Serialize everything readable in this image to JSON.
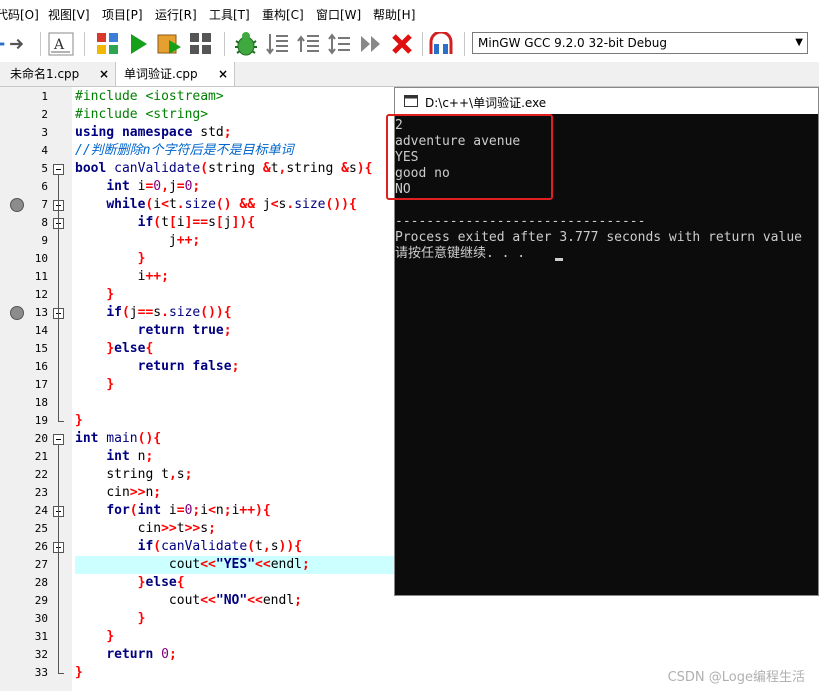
{
  "menu": [
    "代码[O]",
    "视图[V]",
    "项目[P]",
    "运行[R]",
    "工具[T]",
    "重构[C]",
    "窗口[W]",
    "帮助[H]"
  ],
  "toolbar": {
    "compiler": "MinGW GCC 9.2.0 32-bit Debug",
    "icons": [
      "forward-arrow-icon",
      "format-icon",
      "new-project-icon",
      "run-icon",
      "compile-run-icon",
      "grid-icon",
      "debug-bug-icon",
      "step-list-icon",
      "step-over-icon",
      "step-out-icon",
      "continue-icon",
      "stop-icon",
      "profile-icon"
    ]
  },
  "tabs": [
    {
      "label": "未命名1.cpp",
      "close": "×"
    },
    {
      "label": "单词验证.cpp",
      "close": "×"
    }
  ],
  "editor": {
    "line_numbers": [
      "1",
      "2",
      "3",
      "4",
      "5",
      "6",
      "7",
      "8",
      "9",
      "10",
      "11",
      "12",
      "13",
      "14",
      "15",
      "16",
      "17",
      "18",
      "19",
      "20",
      "21",
      "22",
      "23",
      "24",
      "25",
      "26",
      "27",
      "28",
      "29",
      "30",
      "31",
      "32",
      "33"
    ],
    "lines": [
      [
        {
          "t": "#include <iostream>",
          "c": "pp"
        }
      ],
      [
        {
          "t": "#include <string>",
          "c": "pp"
        }
      ],
      [
        {
          "t": "using",
          "c": "kw"
        },
        {
          "t": " ",
          "c": "id"
        },
        {
          "t": "namespace",
          "c": "kw"
        },
        {
          "t": " std",
          "c": "id"
        },
        {
          "t": ";",
          "c": "op"
        }
      ],
      [
        {
          "t": "//判断删除n个字符后是不是目标单词",
          "c": "cm"
        }
      ],
      [
        {
          "t": "bool",
          "c": "kw"
        },
        {
          "t": " canValidate",
          "c": "fn"
        },
        {
          "t": "(",
          "c": "op"
        },
        {
          "t": "string ",
          "c": "ty"
        },
        {
          "t": "&",
          "c": "op"
        },
        {
          "t": "t",
          "c": "id"
        },
        {
          "t": ",",
          "c": "op"
        },
        {
          "t": "string ",
          "c": "ty"
        },
        {
          "t": "&",
          "c": "op"
        },
        {
          "t": "s",
          "c": "id"
        },
        {
          "t": "){",
          "c": "op"
        }
      ],
      [
        {
          "t": "    ",
          "c": "id"
        },
        {
          "t": "int",
          "c": "kw"
        },
        {
          "t": " i",
          "c": "id"
        },
        {
          "t": "=",
          "c": "op"
        },
        {
          "t": "0",
          "c": "num"
        },
        {
          "t": ",",
          "c": "op"
        },
        {
          "t": "j",
          "c": "id"
        },
        {
          "t": "=",
          "c": "op"
        },
        {
          "t": "0",
          "c": "num"
        },
        {
          "t": ";",
          "c": "op"
        }
      ],
      [
        {
          "t": "    ",
          "c": "id"
        },
        {
          "t": "while",
          "c": "kw"
        },
        {
          "t": "(",
          "c": "op"
        },
        {
          "t": "i",
          "c": "id"
        },
        {
          "t": "<",
          "c": "op"
        },
        {
          "t": "t",
          "c": "id"
        },
        {
          "t": ".",
          "c": "op"
        },
        {
          "t": "size",
          "c": "fn"
        },
        {
          "t": "() ",
          "c": "op"
        },
        {
          "t": "&&",
          "c": "op"
        },
        {
          "t": " j",
          "c": "id"
        },
        {
          "t": "<",
          "c": "op"
        },
        {
          "t": "s",
          "c": "id"
        },
        {
          "t": ".",
          "c": "op"
        },
        {
          "t": "size",
          "c": "fn"
        },
        {
          "t": "()){",
          "c": "op"
        }
      ],
      [
        {
          "t": "        ",
          "c": "id"
        },
        {
          "t": "if",
          "c": "kw"
        },
        {
          "t": "(",
          "c": "op"
        },
        {
          "t": "t",
          "c": "id"
        },
        {
          "t": "[",
          "c": "op"
        },
        {
          "t": "i",
          "c": "id"
        },
        {
          "t": "]==",
          "c": "op"
        },
        {
          "t": "s",
          "c": "id"
        },
        {
          "t": "[",
          "c": "op"
        },
        {
          "t": "j",
          "c": "id"
        },
        {
          "t": "]){",
          "c": "op"
        }
      ],
      [
        {
          "t": "            ",
          "c": "id"
        },
        {
          "t": "j",
          "c": "id"
        },
        {
          "t": "++;",
          "c": "op"
        }
      ],
      [
        {
          "t": "        ",
          "c": "id"
        },
        {
          "t": "}",
          "c": "op"
        }
      ],
      [
        {
          "t": "        ",
          "c": "id"
        },
        {
          "t": "i",
          "c": "id"
        },
        {
          "t": "++;",
          "c": "op"
        }
      ],
      [
        {
          "t": "    ",
          "c": "id"
        },
        {
          "t": "}",
          "c": "op"
        }
      ],
      [
        {
          "t": "    ",
          "c": "id"
        },
        {
          "t": "if",
          "c": "kw"
        },
        {
          "t": "(",
          "c": "op"
        },
        {
          "t": "j",
          "c": "id"
        },
        {
          "t": "==",
          "c": "op"
        },
        {
          "t": "s",
          "c": "id"
        },
        {
          "t": ".",
          "c": "op"
        },
        {
          "t": "size",
          "c": "fn"
        },
        {
          "t": "()){",
          "c": "op"
        }
      ],
      [
        {
          "t": "        ",
          "c": "id"
        },
        {
          "t": "return",
          "c": "kw"
        },
        {
          "t": " ",
          "c": "id"
        },
        {
          "t": "true",
          "c": "kw"
        },
        {
          "t": ";",
          "c": "op"
        }
      ],
      [
        {
          "t": "    ",
          "c": "id"
        },
        {
          "t": "}",
          "c": "op"
        },
        {
          "t": "else",
          "c": "kw"
        },
        {
          "t": "{",
          "c": "op"
        }
      ],
      [
        {
          "t": "        ",
          "c": "id"
        },
        {
          "t": "return",
          "c": "kw"
        },
        {
          "t": " ",
          "c": "id"
        },
        {
          "t": "false",
          "c": "kw"
        },
        {
          "t": ";",
          "c": "op"
        }
      ],
      [
        {
          "t": "    ",
          "c": "id"
        },
        {
          "t": "}",
          "c": "op"
        }
      ],
      [
        {
          "t": "",
          "c": "id"
        }
      ],
      [
        {
          "t": "}",
          "c": "br"
        }
      ],
      [
        {
          "t": "int",
          "c": "kw"
        },
        {
          "t": " main",
          "c": "fn"
        },
        {
          "t": "(){",
          "c": "op"
        }
      ],
      [
        {
          "t": "    ",
          "c": "id"
        },
        {
          "t": "int",
          "c": "kw"
        },
        {
          "t": " n",
          "c": "id"
        },
        {
          "t": ";",
          "c": "op"
        }
      ],
      [
        {
          "t": "    ",
          "c": "id"
        },
        {
          "t": "string t",
          "c": "id"
        },
        {
          "t": ",",
          "c": "op"
        },
        {
          "t": "s",
          "c": "id"
        },
        {
          "t": ";",
          "c": "op"
        }
      ],
      [
        {
          "t": "    ",
          "c": "id"
        },
        {
          "t": "cin",
          "c": "id"
        },
        {
          "t": ">>",
          "c": "op"
        },
        {
          "t": "n",
          "c": "id"
        },
        {
          "t": ";",
          "c": "op"
        }
      ],
      [
        {
          "t": "    ",
          "c": "id"
        },
        {
          "t": "for",
          "c": "kw"
        },
        {
          "t": "(",
          "c": "op"
        },
        {
          "t": "int",
          "c": "kw"
        },
        {
          "t": " i",
          "c": "id"
        },
        {
          "t": "=",
          "c": "op"
        },
        {
          "t": "0",
          "c": "num"
        },
        {
          "t": ";",
          "c": "op"
        },
        {
          "t": "i",
          "c": "id"
        },
        {
          "t": "<",
          "c": "op"
        },
        {
          "t": "n",
          "c": "id"
        },
        {
          "t": ";",
          "c": "op"
        },
        {
          "t": "i",
          "c": "id"
        },
        {
          "t": "++){",
          "c": "op"
        }
      ],
      [
        {
          "t": "        ",
          "c": "id"
        },
        {
          "t": "cin",
          "c": "id"
        },
        {
          "t": ">>",
          "c": "op"
        },
        {
          "t": "t",
          "c": "id"
        },
        {
          "t": ">>",
          "c": "op"
        },
        {
          "t": "s",
          "c": "id"
        },
        {
          "t": ";",
          "c": "op"
        }
      ],
      [
        {
          "t": "        ",
          "c": "id"
        },
        {
          "t": "if",
          "c": "kw"
        },
        {
          "t": "(",
          "c": "op"
        },
        {
          "t": "canValidate",
          "c": "fn"
        },
        {
          "t": "(",
          "c": "op"
        },
        {
          "t": "t",
          "c": "id"
        },
        {
          "t": ",",
          "c": "op"
        },
        {
          "t": "s",
          "c": "id"
        },
        {
          "t": ")){",
          "c": "op"
        }
      ],
      [
        {
          "t": "            ",
          "c": "id"
        },
        {
          "t": "cout",
          "c": "id"
        },
        {
          "t": "<<",
          "c": "op"
        },
        {
          "t": "\"YES\"",
          "c": "str"
        },
        {
          "t": "<<",
          "c": "op"
        },
        {
          "t": "endl",
          "c": "id"
        },
        {
          "t": ";",
          "c": "op"
        }
      ],
      [
        {
          "t": "        ",
          "c": "id"
        },
        {
          "t": "}",
          "c": "op"
        },
        {
          "t": "else",
          "c": "kw"
        },
        {
          "t": "{",
          "c": "op"
        }
      ],
      [
        {
          "t": "            ",
          "c": "id"
        },
        {
          "t": "cout",
          "c": "id"
        },
        {
          "t": "<<",
          "c": "op"
        },
        {
          "t": "\"NO\"",
          "c": "str"
        },
        {
          "t": "<<",
          "c": "op"
        },
        {
          "t": "endl",
          "c": "id"
        },
        {
          "t": ";",
          "c": "op"
        }
      ],
      [
        {
          "t": "        ",
          "c": "id"
        },
        {
          "t": "}",
          "c": "op"
        }
      ],
      [
        {
          "t": "    ",
          "c": "id"
        },
        {
          "t": "}",
          "c": "op"
        }
      ],
      [
        {
          "t": "    ",
          "c": "id"
        },
        {
          "t": "return",
          "c": "kw"
        },
        {
          "t": " ",
          "c": "id"
        },
        {
          "t": "0",
          "c": "num"
        },
        {
          "t": ";",
          "c": "op"
        }
      ],
      [
        {
          "t": "}",
          "c": "br"
        }
      ]
    ],
    "highlighted_line": "27",
    "breakpoint_lines": [
      "7",
      "13"
    ],
    "fold_lines": [
      "5",
      "7",
      "8",
      "13",
      "20",
      "24",
      "26"
    ]
  },
  "console": {
    "title": "D:\\c++\\单词验证.exe",
    "output": [
      "2",
      "adventure avenue",
      "YES",
      "good no",
      "NO",
      "",
      "--------------------------------",
      "Process exited after 3.777 seconds with return value",
      "请按任意键继续. . . "
    ]
  },
  "watermark": "CSDN @Loge编程生活",
  "colors": {
    "highlight": "#ccffff",
    "annotation_box": "#e02020",
    "console_bg": "#0c0c0c"
  }
}
